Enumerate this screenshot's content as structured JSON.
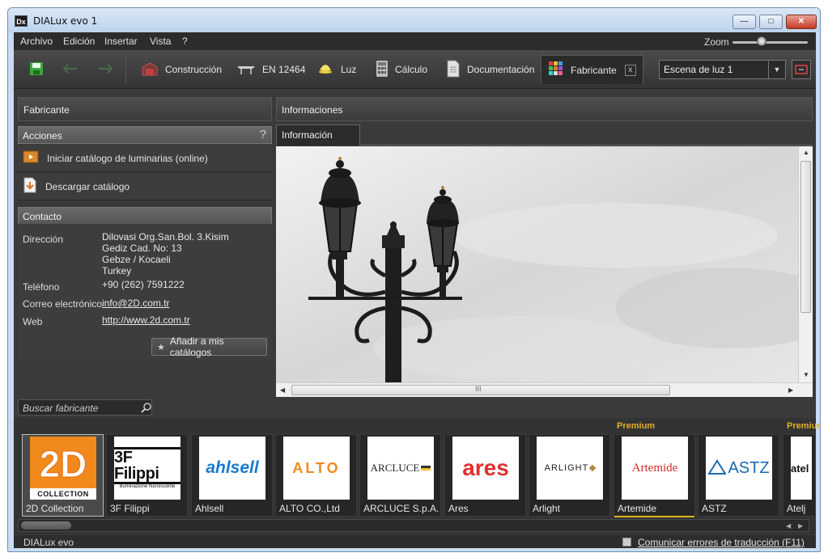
{
  "window": {
    "title": "DIALux evo 1",
    "app_icon": "Dx"
  },
  "menu": [
    "Archivo",
    "Edición",
    "Insertar",
    "Vista",
    "?"
  ],
  "zoom": {
    "label": "Zoom",
    "value_fraction": 0.35
  },
  "toolbar": {
    "tabs": [
      {
        "label": "Construcción",
        "icon": "building-icon"
      },
      {
        "label": "EN 12464",
        "icon": "table-icon"
      },
      {
        "label": "Luz",
        "icon": "lamp-icon"
      },
      {
        "label": "Cálculo",
        "icon": "calculator-icon"
      },
      {
        "label": "Documentación",
        "icon": "document-icon"
      },
      {
        "label": "Fabricante",
        "icon": "catalog-icon"
      }
    ],
    "close_glyph": "x",
    "scene": "Escena de luz 1"
  },
  "left": {
    "title": "Fabricante",
    "actions_header": "Acciones",
    "help": "?",
    "actions": [
      "Iniciar catálogo de luminarias (online)",
      "Descargar catálogo"
    ],
    "contact_header": "Contacto",
    "contact": {
      "address_label": "Dirección",
      "address": [
        "Dilovasi Org.San.Bol. 3.Kisim",
        "Gediz Cad. No: 13",
        "Gebze / Kocaeli",
        "Turkey"
      ],
      "phone_label": "Teléfono",
      "phone": "+90 (262) 7591222",
      "email_label": "Correo electrónico",
      "email": "info@2D.com.tr",
      "web_label": "Web",
      "web": "http://www.2d.com.tr"
    },
    "add_button": "Añadir a mis catálogos"
  },
  "right": {
    "title": "Informaciones",
    "tab": "Información",
    "scroll_glyph": "III"
  },
  "manufacturers": {
    "search_placeholder": "Buscar fabricante",
    "premium_label": "Premium",
    "items": [
      {
        "name": "2D Collection",
        "premium": false,
        "logo": "2D"
      },
      {
        "name": "3F Filippi",
        "premium": false,
        "logo": "3F Filippi"
      },
      {
        "name": "Ahlsell",
        "premium": false,
        "logo": "ahlsell"
      },
      {
        "name": "ALTO CO.,Ltd",
        "premium": false,
        "logo": "ALTO"
      },
      {
        "name": "ARCLUCE S.p.A.",
        "premium": false,
        "logo": "ARCLUCE"
      },
      {
        "name": "Ares",
        "premium": false,
        "logo": "ares"
      },
      {
        "name": "Arlight",
        "premium": false,
        "logo": "ARLIGHT"
      },
      {
        "name": "Artemide",
        "premium": true,
        "logo": "Artemide"
      },
      {
        "name": "ASTZ",
        "premium": false,
        "logo": "ASTZ"
      },
      {
        "name": "Atelj",
        "premium": true,
        "logo": "atel"
      }
    ]
  },
  "status": {
    "brand": "DIALux evo",
    "report": "Comunicar errores de traducción (F11)"
  },
  "colors": {
    "accent": "#e0b020",
    "ares_red": "#e03030",
    "alto_orange": "#f08a20",
    "ahlsell_blue": "#1a7ad0"
  }
}
